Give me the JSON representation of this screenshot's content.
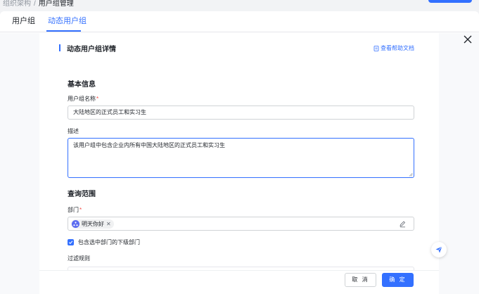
{
  "breadcrumb": {
    "parent": "组织架构",
    "separator": "/",
    "current": "用户组管理"
  },
  "tabs": [
    {
      "label": "用户组",
      "active": false
    },
    {
      "label": "动态用户组",
      "active": true
    }
  ],
  "drawer": {
    "title": "动态用户组详情",
    "help_link": "查看帮助文档",
    "basic_section": "基本信息",
    "name_label": "用户组名称",
    "name_value": "大陆地区的正式员工和实习生",
    "desc_label": "描述",
    "desc_value": "该用户组中包含企业内所有中国大陆地区的正式员工和实习生",
    "scope_section": "查询范围",
    "dept_label": "部门",
    "dept_tag": "明天你好",
    "include_sub_label": "包含选中部门的下级部门",
    "include_sub_checked": true,
    "filter_label": "过滤规则"
  },
  "footer": {
    "cancel": "取 消",
    "ok": "确 定"
  },
  "colors": {
    "accent": "#3370ff",
    "required": "#f54a45"
  },
  "icons": [
    "close-icon",
    "help-doc-icon",
    "department-avatar-icon",
    "remove-tag-icon",
    "edit-icon",
    "checkmark-icon",
    "send-icon"
  ]
}
